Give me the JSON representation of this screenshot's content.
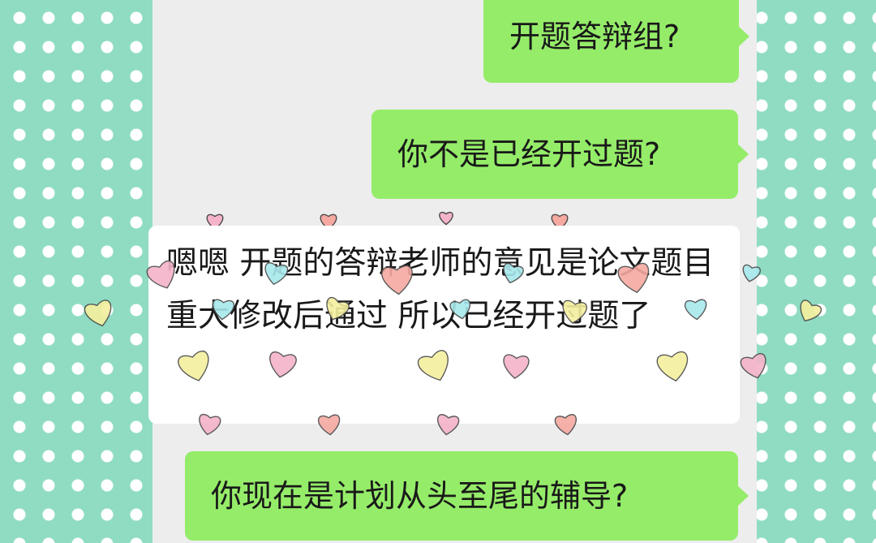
{
  "chat": {
    "messages": [
      {
        "id": "bubble-1",
        "sender": "me",
        "text": "开题答辩组?"
      },
      {
        "id": "bubble-2",
        "sender": "me",
        "text": "你不是已经开过题?"
      },
      {
        "id": "bubble-3",
        "sender": "other",
        "text": "嗯嗯 开题的答辩老师的意见是论文题目重大修改后通过 所以已经开过题了"
      },
      {
        "id": "bubble-4",
        "sender": "me",
        "text": "你现在是计划从头至尾的辅导?"
      }
    ]
  },
  "colors": {
    "sent_bubble": "#95ec69",
    "received_bubble": "#ffffff",
    "chat_background": "#ededed",
    "polka_background": "#8fdcc3",
    "heart_pink": "#f4b3c8",
    "heart_yellow": "#f5ef9e",
    "heart_cyan": "#a7e8ec",
    "heart_salmon": "#f5a9a1"
  },
  "icons": {
    "sticker": "heart-sticker-icon",
    "background_pattern": "polka-dot-pattern"
  }
}
